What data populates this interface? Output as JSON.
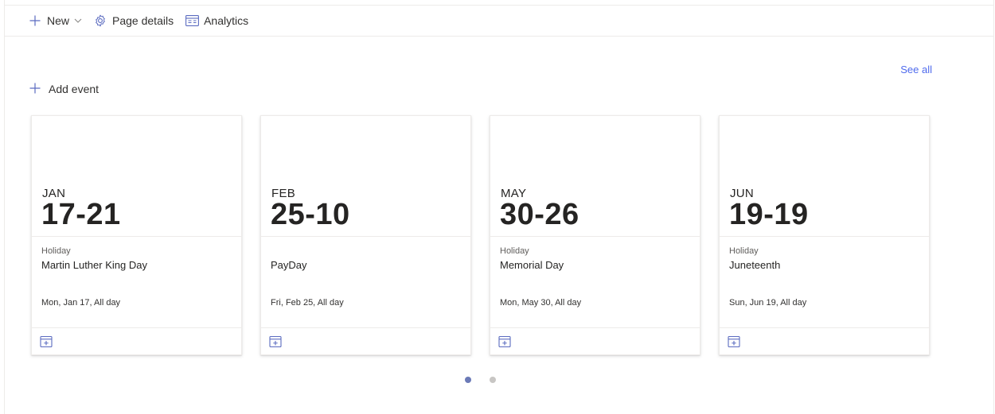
{
  "toolbar": {
    "new_label": "New",
    "page_details_label": "Page details",
    "analytics_label": "Analytics"
  },
  "events_section": {
    "see_all_label": "See all",
    "add_event_label": "Add event"
  },
  "events": [
    {
      "month": "JAN",
      "days": "17-21",
      "category": "Holiday",
      "title": "Martin Luther King Day",
      "when": "Mon, Jan 17, All day"
    },
    {
      "month": "FEB",
      "days": "25-10",
      "category": "",
      "title": "PayDay",
      "when": "Fri, Feb 25, All day"
    },
    {
      "month": "MAY",
      "days": "30-26",
      "category": "Holiday",
      "title": "Memorial Day",
      "when": "Mon, May 30, All day"
    },
    {
      "month": "JUN",
      "days": "19-19",
      "category": "Holiday",
      "title": "Juneteenth",
      "when": "Sun, Jun 19, All day"
    }
  ],
  "pager": {
    "pages": 2,
    "active": 1
  },
  "colors": {
    "accent": "#4f6bed",
    "icon": "#5b6bc0",
    "dot_active": "#6b7ab7",
    "dot_inactive": "#c8c6c4"
  },
  "icons": [
    "plus-icon",
    "chevron-down-icon",
    "gear-icon",
    "analytics-icon",
    "calendar-add-icon"
  ]
}
